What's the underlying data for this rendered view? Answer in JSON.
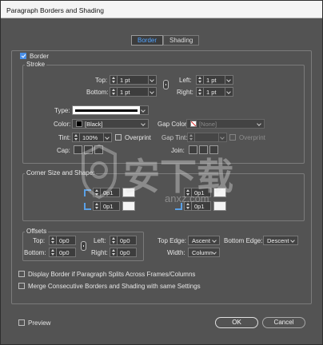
{
  "window": {
    "title": "Paragraph Borders and Shading"
  },
  "tabs": [
    {
      "label": "Border"
    },
    {
      "label": "Shading"
    }
  ],
  "border": {
    "label": "Border",
    "checked": true
  },
  "stroke": {
    "legend": "Stroke",
    "top_label": "Top:",
    "top_value": "1 pt",
    "bottom_label": "Bottom:",
    "bottom_value": "1 pt",
    "left_label": "Left:",
    "left_value": "1 pt",
    "right_label": "Right:",
    "right_value": "1 pt",
    "type_label": "Type:",
    "color_label": "Color:",
    "color_value": "[Black]",
    "gap_color_label": "Gap Color:",
    "gap_color_value": "[None]",
    "tint_label": "Tint:",
    "tint_value": "100%",
    "overprint_label": "Overprint",
    "gap_tint_label": "Gap Tint:",
    "gap_overprint_label": "Overprint",
    "cap_label": "Cap:",
    "join_label": "Join:"
  },
  "corner": {
    "legend": "Corner Size and Shape:",
    "tl_value": "0p1",
    "bl_value": "0p1",
    "tr_value": "0p1",
    "br_value": "0p1"
  },
  "offsets": {
    "legend": "Offsets",
    "top_label": "Top:",
    "top_value": "0p0",
    "bottom_label": "Bottom:",
    "bottom_value": "0p0",
    "left_label": "Left:",
    "left_value": "0p0",
    "right_label": "Right:",
    "right_value": "0p0"
  },
  "edges": {
    "top_edge_label": "Top Edge:",
    "top_edge_value": "Ascent",
    "bottom_edge_label": "Bottom Edge:",
    "bottom_edge_value": "Descent",
    "width_label": "Width:",
    "width_value": "Column"
  },
  "options": {
    "display_border_label": "Display Border if Paragraph Splits Across Frames/Columns",
    "merge_label": "Merge Consecutive Borders and Shading with same Settings"
  },
  "footer": {
    "preview_label": "Preview",
    "ok_label": "OK",
    "cancel_label": "Cancel"
  },
  "watermark": {
    "text": "安下载",
    "subtext": "anxz.com"
  },
  "colors": {
    "accent": "#4fa2ff",
    "dialog_bg": "#535353",
    "checkbox": "#4a8fe8"
  }
}
